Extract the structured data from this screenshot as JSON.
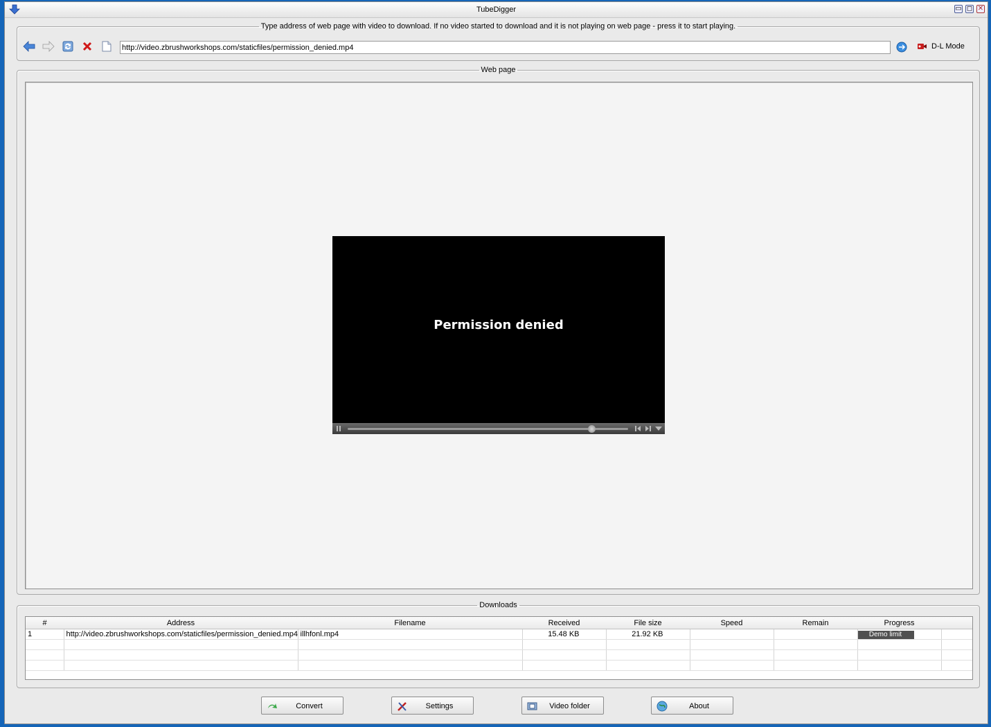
{
  "window": {
    "title": "TubeDigger"
  },
  "url_bar": {
    "legend": "Type address of web page with video to download. If no video started to download and it is not playing on web page - press it to start playing.",
    "url": "http://video.zbrushworkshops.com/staticfiles/permission_denied.mp4",
    "dl_mode_label": "D-L Mode"
  },
  "web_page": {
    "legend": "Web page",
    "player_message": "Permission denied",
    "player_progress": 0.87
  },
  "downloads": {
    "legend": "Downloads",
    "columns": [
      "#",
      "Address",
      "Filename",
      "Received",
      "File size",
      "Speed",
      "Remain",
      "Progress"
    ],
    "rows": [
      {
        "index": "1",
        "address": "http://video.zbrushworkshops.com/staticfiles/permission_denied.mp4",
        "filename": "illhfonl.mp4",
        "received": "15.48 KB",
        "file_size": "21.92 KB",
        "speed": "",
        "remain": "",
        "progress": "Demo limit"
      }
    ]
  },
  "buttons": {
    "convert": "Convert",
    "settings": "Settings",
    "video_folder": "Video folder",
    "about": "About"
  },
  "colors": {
    "desktop": "#1565b8",
    "window": "#eaeaea",
    "player": "#000000"
  }
}
